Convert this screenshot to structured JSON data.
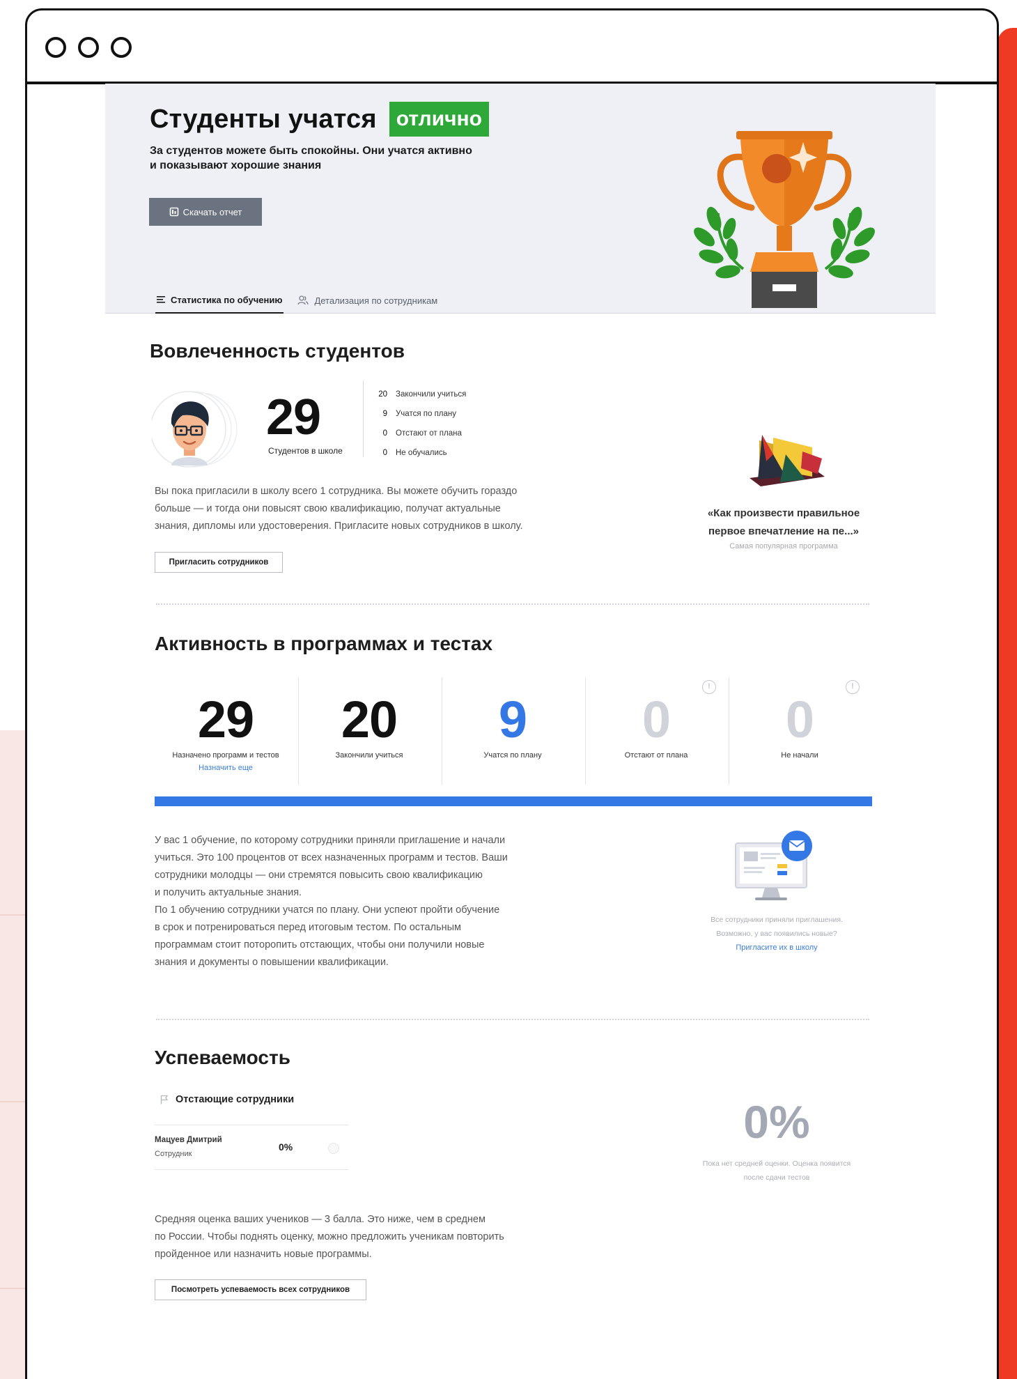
{
  "hero": {
    "title": "Студенты учатся",
    "badge": "отлично",
    "subtitle_line1": "За студентов можете быть спокойны. Они учатся активно",
    "subtitle_line2": "и показывают хорошие знания",
    "download_label": "Скачать отчет"
  },
  "tabs": [
    {
      "label": "Статистика по обучению",
      "active": true
    },
    {
      "label": "Детализация по сотрудникам",
      "active": false
    }
  ],
  "engagement": {
    "title": "Вовлеченность студентов",
    "total": "29",
    "total_label": "Студентов в школе",
    "stats": [
      {
        "value": "20",
        "label": "Закончили учиться"
      },
      {
        "value": "9",
        "label": "Учатся по плану"
      },
      {
        "value": "0",
        "label": "Отстают от плана"
      },
      {
        "value": "0",
        "label": "Не обучались"
      }
    ],
    "text_lines": [
      "Вы пока пригласили в школу всего 1 сотрудника. Вы можете обучить гораздо",
      "больше — и тогда они повысят свою квалификацию, получат актуальные",
      "знания, дипломы или удостоверения. Пригласите новых сотрудников в школу."
    ],
    "invite_button": "Пригласить сотрудников",
    "promo_title_line1": "«Как произвести правильное",
    "promo_title_line2": "первое впечатление на пе...»",
    "promo_subtitle": "Самая популярная программа"
  },
  "activity": {
    "title": "Активность в программах и тестах",
    "columns": [
      {
        "value": "29",
        "label": "Назначено программ и тестов",
        "link": "Назначить еще"
      },
      {
        "value": "20",
        "label": "Закончили учиться"
      },
      {
        "value": "9",
        "label": "Учатся по плану"
      },
      {
        "value": "0",
        "label": "Отстают от плана",
        "info": "!"
      },
      {
        "value": "0",
        "label": "Не начали",
        "info": "!"
      }
    ],
    "progress_fraction": 1.0,
    "text_lines": [
      "У вас 1 обучение, по которому сотрудники приняли приглашение и начали",
      "учиться. Это 100 процентов от всех назначенных программ и тестов. Ваши",
      "сотрудники молодцы — они стремятся повысить свою квалификацию",
      "и получить актуальные знания.",
      "По 1 обучению сотрудники учатся по плану. Они успеют пройти обучение",
      "в срок и потренироваться перед итоговым тестом. По остальным",
      "программам стоит поторопить отстающих, чтобы они получили новые",
      "знания и документы о повышении квалификации."
    ],
    "side_note_line1": "Все сотрудники приняли приглашения.",
    "side_note_line2": "Возможно, у вас появились новые?",
    "side_link": "Пригласите их в школу"
  },
  "performance": {
    "title": "Успеваемость",
    "lagging_header": "Отстающие сотрудники",
    "employee": {
      "name": "Мацуев Дмитрий",
      "role": "Сотрудник",
      "percent": "0%"
    },
    "average_percent": "0%",
    "average_note_line1": "Пока нет средней оценки. Оценка появится",
    "average_note_line2": "после сдачи тестов",
    "text_lines": [
      "Средняя оценка ваших учеников — 3 балла. Это ниже, чем в среднем",
      "по России. Чтобы поднять оценку, можно предложить ученикам повторить",
      "пройденное или назначить новые программы."
    ],
    "view_button": "Посмотреть успеваемость всех сотрудников"
  },
  "colors": {
    "accent_green": "#2fa83a",
    "accent_blue": "#3478e5",
    "brand_red": "#ee3a22",
    "trophy_orange": "#f28a2a"
  }
}
